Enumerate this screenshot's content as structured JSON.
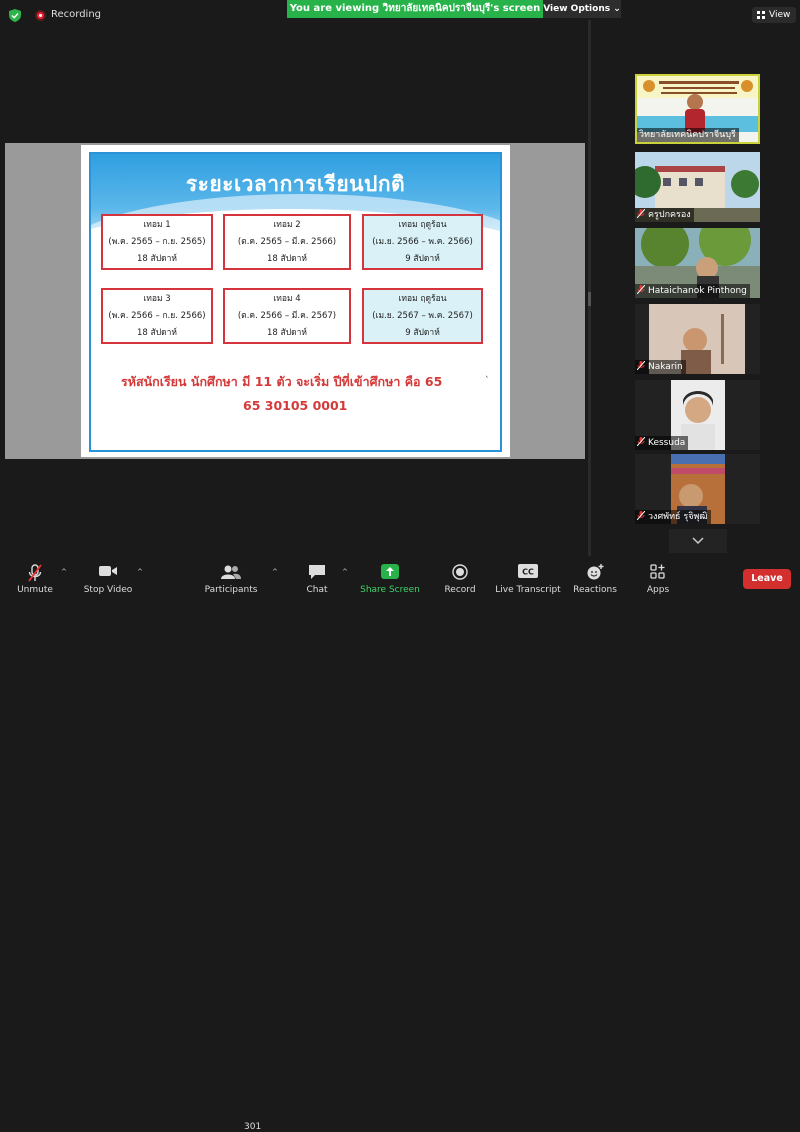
{
  "top": {
    "recording_label": "Recording",
    "viewing_banner": "You are viewing วิทยาลัยเทคนิคปราจีนบุรี's screen",
    "view_options": "View Options",
    "view_button": "View"
  },
  "slide": {
    "title": "ระยะเวลาการเรียนปกติ",
    "terms": [
      {
        "name": "เทอม 1",
        "range": "(พ.ค. 2565 – ก.ย. 2565)",
        "weeks": "18 สัปดาห์"
      },
      {
        "name": "เทอม 2",
        "range": "(ต.ค. 2565 – มี.ค. 2566)",
        "weeks": "18 สัปดาห์"
      },
      {
        "name": "เทอม ฤดูร้อน",
        "range": "(เม.ย. 2566 – พ.ค. 2566)",
        "weeks": "9 สัปดาห์"
      },
      {
        "name": "เทอม 3",
        "range": "(พ.ค. 2566 – ก.ย. 2566)",
        "weeks": "18 สัปดาห์"
      },
      {
        "name": "เทอม 4",
        "range": "(ต.ค. 2566 – มี.ค. 2567)",
        "weeks": "18 สัปดาห์"
      },
      {
        "name": "เทอม ฤดูร้อน",
        "range": "(เม.ย. 2567 – พ.ค. 2567)",
        "weeks": "9 สัปดาห์"
      }
    ],
    "note": "รหัสนักเรียน นักศึกษา มี 11 ตัว จะเริ่ม ปีที่เข้าศึกษา คือ 65",
    "code": "65 30105 0001",
    "stray_mark": "ˋ"
  },
  "participants": [
    {
      "name": "วิทยาลัยเทคนิคปราจีนบุรี",
      "muted": false
    },
    {
      "name": "ครูปกครอง",
      "muted": true
    },
    {
      "name": "Hataichanok Pinthong",
      "muted": true
    },
    {
      "name": "Nakarin",
      "muted": true
    },
    {
      "name": "Kessuda",
      "muted": true
    },
    {
      "name": "วงศพัทธ์ รุจิพุฒิ",
      "muted": true
    }
  ],
  "toolbar": {
    "unmute": "Unmute",
    "stop_video": "Stop Video",
    "participants": "Participants",
    "participants_count": "301",
    "chat": "Chat",
    "share_screen": "Share Screen",
    "record": "Record",
    "live_transcript": "Live Transcript",
    "reactions": "Reactions",
    "apps": "Apps",
    "leave": "Leave"
  },
  "colors": {
    "share_green": "#27b34a",
    "leave_red": "#d32f2f",
    "slide_red": "#d43a3a",
    "slide_blue": "#2f9fe0"
  }
}
